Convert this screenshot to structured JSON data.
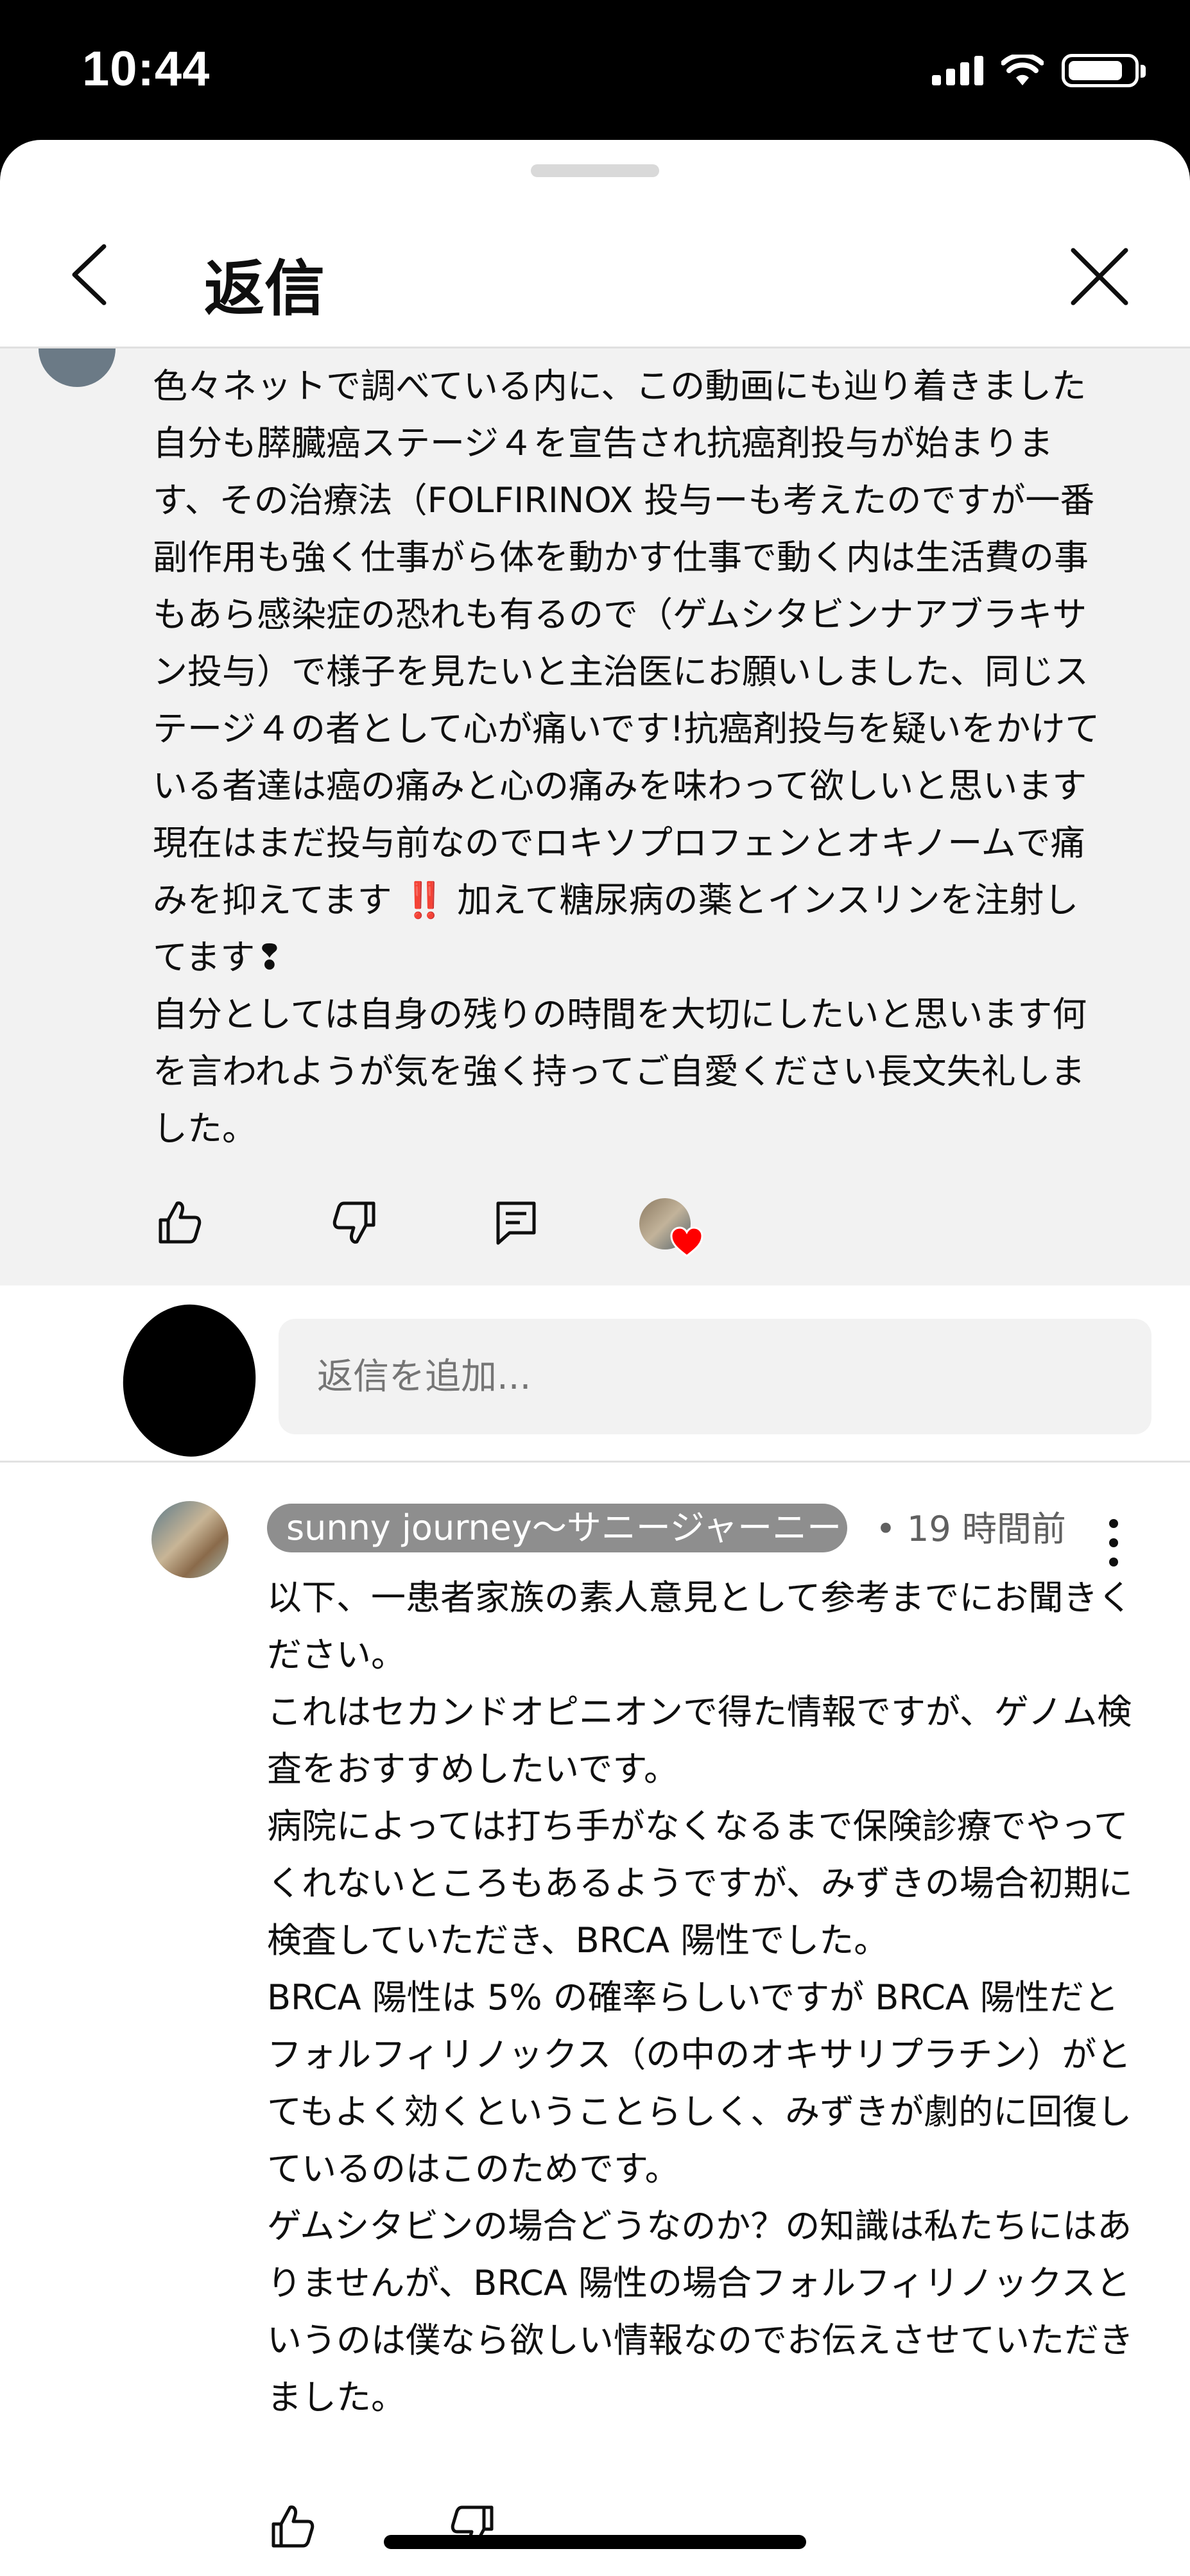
{
  "status_bar": {
    "time": "10:44",
    "battery_level": 0.85
  },
  "header": {
    "title": "返信"
  },
  "parent_comment": {
    "text": "色々ネットで調べている内に、この動画にも辿り着きました自分も膵臓癌ステージ４を宣告され抗癌剤投与が始まります、その治療法（FOLFIRINOX 投与ーも考えたのですが一番副作用も強く仕事がら体を動かす仕事で動く内は生活費の事もあら感染症の恐れも有るので（ゲムシタビンナアブラキサン投与）で様子を見たいと主治医にお願いしました、同じステージ４の者として心が痛いです!抗癌剤投与を疑いをかけている者達は癌の痛みと心の痛みを味わって欲しいと思います現在はまだ投与前なのでロキソプロフェンとオキノームで痛みを抑えてます ‼️ 加えて糖尿病の薬とインスリンを注射してます❢\n自分としては自身の残りの時間を大切にしたいと思います何を言われようが気を強く持ってご自愛ください長文失礼しました。",
    "icons": [
      "thumbs-up-icon",
      "thumbs-down-icon",
      "reply-icon",
      "creator-heart-icon"
    ]
  },
  "add_reply": {
    "placeholder": "返信を追加..."
  },
  "reply_comment": {
    "author": "sunny journey～サニージャーニー",
    "time": "• 19 時間前",
    "text": "以下、一患者家族の素人意見として参考までにお聞きください。\nこれはセカンドオピニオンで得た情報ですが、ゲノム検査をおすすめしたいです。\n病院によっては打ち手がなくなるまで保険診療でやってくれないところもあるようですが、みずきの場合初期に検査していただき、BRCA 陽性でした。\nBRCA 陽性は 5% の確率らしいですが BRCA 陽性だとフォルフィリノックス（の中のオキサリプラチン）がとてもよく効くということらしく、みずきが劇的に回復しているのはこのためです。\nゲムシタビンの場合どうなのか？の知識は私たちにはありませんが、BRCA 陽性の場合フォルフィリノックスというのは僕なら欲しい情報なのでお伝えさせていただきました。",
    "icons": [
      "thumbs-up-icon",
      "thumbs-down-icon"
    ]
  },
  "colors": {
    "heart": "#ff0000",
    "grey_bg": "#f2f2f2",
    "chip": "#8e8e8e"
  }
}
